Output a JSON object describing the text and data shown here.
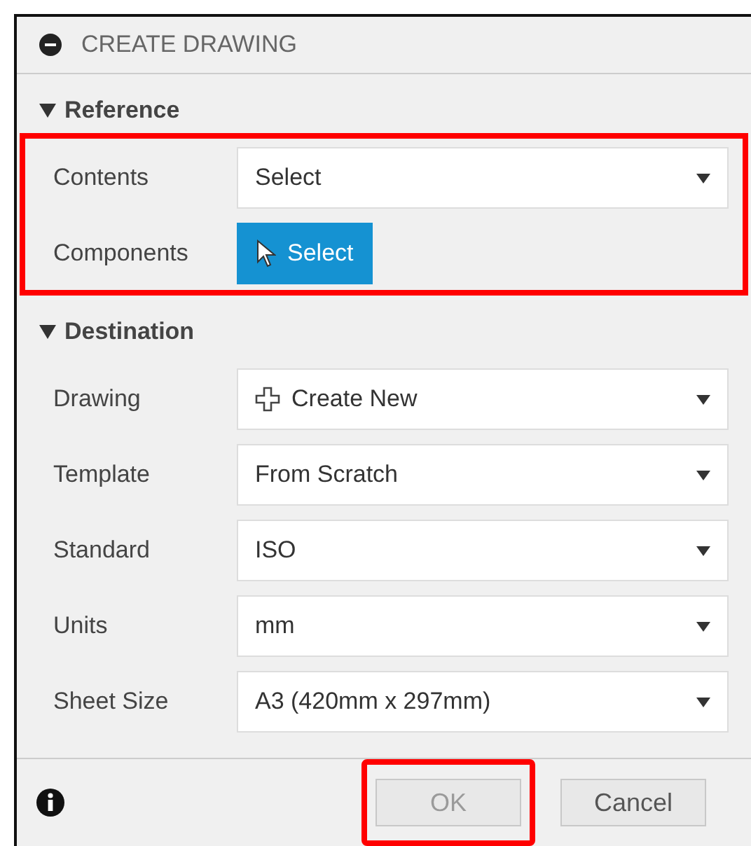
{
  "window": {
    "title": "CREATE DRAWING"
  },
  "sections": [
    {
      "title": "Reference",
      "expanded": true,
      "highlighted": true,
      "rows": [
        {
          "label": "Contents",
          "kind": "dropdown",
          "value": "Select"
        },
        {
          "label": "Components",
          "kind": "select-button",
          "value": "Select"
        }
      ]
    },
    {
      "title": "Destination",
      "expanded": true,
      "highlighted": false,
      "rows": [
        {
          "label": "Drawing",
          "kind": "new-dropdown",
          "value": "Create New"
        },
        {
          "label": "Template",
          "kind": "dropdown",
          "value": "From Scratch"
        },
        {
          "label": "Standard",
          "kind": "dropdown",
          "value": "ISO"
        },
        {
          "label": "Units",
          "kind": "dropdown",
          "value": "mm"
        },
        {
          "label": "Sheet Size",
          "kind": "dropdown",
          "value": "A3 (420mm x 297mm)"
        }
      ]
    }
  ],
  "buttons": [
    {
      "label": "OK",
      "disabled": true,
      "highlighted": true
    },
    {
      "label": "Cancel",
      "disabled": false,
      "highlighted": false
    }
  ]
}
